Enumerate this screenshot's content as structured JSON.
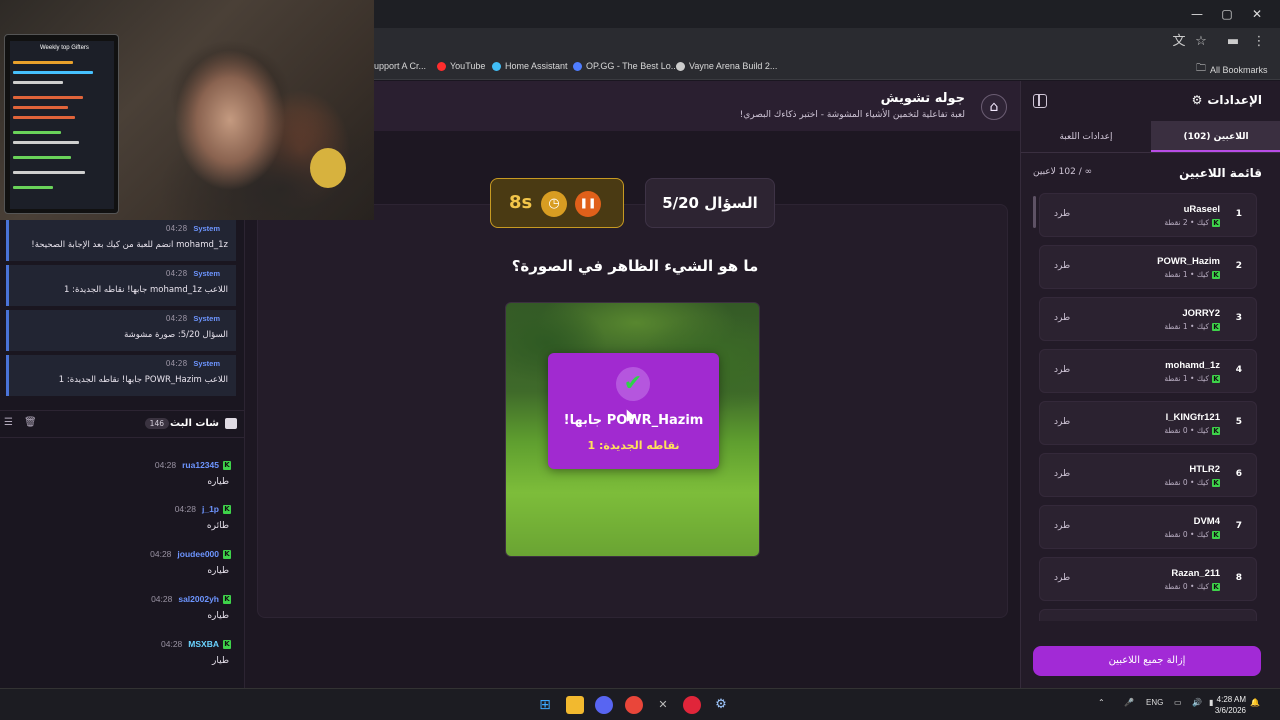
{
  "browser": {
    "bookmarks": [
      {
        "label": "upport A Cr...",
        "color": "#e8e8e8"
      },
      {
        "label": "YouTube",
        "color": "#ff2d2d"
      },
      {
        "label": "Home Assistant",
        "color": "#41bdf5"
      },
      {
        "label": "OP.GG - The Best Lo...",
        "color": "#4f7dff"
      },
      {
        "label": "Vayne Arena Build 2...",
        "color": "#cccccc"
      }
    ],
    "all_bookmarks": "All Bookmarks"
  },
  "header": {
    "title": "جوله تشويش",
    "subtitle": "لعبة تفاعلية لتخمين الأشياء المشوشة - اختبر ذكاءك البصري!"
  },
  "game": {
    "timer": "8s",
    "question_number": "السؤال 5/20",
    "question": "ما هو الشيء الظاهر في الصورة؟",
    "correct_title": "POWR_Hazim جابها!",
    "correct_points": "نقاطه الجديدة: 1"
  },
  "settings": {
    "title": "الإعدادات",
    "tabs": [
      {
        "label": "اللاعبين (102)",
        "active": true
      },
      {
        "label": "إعدادات اللعبة",
        "active": false
      }
    ],
    "players_title": "قائمة اللاعبين",
    "players_count": "∞ / 102 لاعبين",
    "kick_label": "طرد",
    "remove_all": "إزالة جميع اللاعبين",
    "players": [
      {
        "rank": "1",
        "name": "uRaseel",
        "meta": "كيك • 2 نقطة"
      },
      {
        "rank": "2",
        "name": "POWR_Hazim",
        "meta": "كيك • 1 نقطة"
      },
      {
        "rank": "3",
        "name": "JORRY2",
        "meta": "كيك • 1 نقطة"
      },
      {
        "rank": "4",
        "name": "mohamd_1z",
        "meta": "كيك • 1 نقطة"
      },
      {
        "rank": "5",
        "name": "l_KINGfr121",
        "meta": "كيك • 0 نقطة"
      },
      {
        "rank": "6",
        "name": "HTLR2",
        "meta": "كيك • 0 نقطة"
      },
      {
        "rank": "7",
        "name": "DVM4",
        "meta": "كيك • 0 نقطة"
      },
      {
        "rank": "8",
        "name": "Razan_211",
        "meta": "كيك • 0 نقطة"
      }
    ]
  },
  "chat": {
    "system_messages": [
      {
        "name": "System",
        "time": "04:28",
        "text": "mohamd_1z انضم للعبة من كيك بعد الإجابة الصحيحة!"
      },
      {
        "name": "System",
        "time": "04:28",
        "text": "اللاعب mohamd_1z جابها! نقاطه الجديدة: 1"
      },
      {
        "name": "System",
        "time": "04:28",
        "text": "السؤال 5/20: صورة مشوشة"
      },
      {
        "name": "System",
        "time": "04:28",
        "text": "اللاعب POWR_Hazim جابها! نقاطه الجديدة: 1"
      }
    ],
    "title": "شات البث",
    "count": "146",
    "messages": [
      {
        "user": "rua12345",
        "time": "04:28",
        "text": "طياره",
        "color": "#6d95ff"
      },
      {
        "user": "j_1p",
        "time": "04:28",
        "text": "طائره",
        "color": "#6d95ff"
      },
      {
        "user": "joudee000",
        "time": "04:28",
        "text": "طياره",
        "color": "#6d95ff"
      },
      {
        "user": "sal2002yh",
        "time": "04:28",
        "text": "طياره",
        "color": "#6d95ff"
      },
      {
        "user": "MSXBA",
        "time": "04:28",
        "text": "طيار",
        "color": "#6ad3ff"
      }
    ]
  },
  "webcam": {
    "overlay_title": "Weekly top Gifters"
  },
  "taskbar": {
    "lang": "ENG",
    "time": "4:28 AM",
    "date": "3/6/2026"
  }
}
